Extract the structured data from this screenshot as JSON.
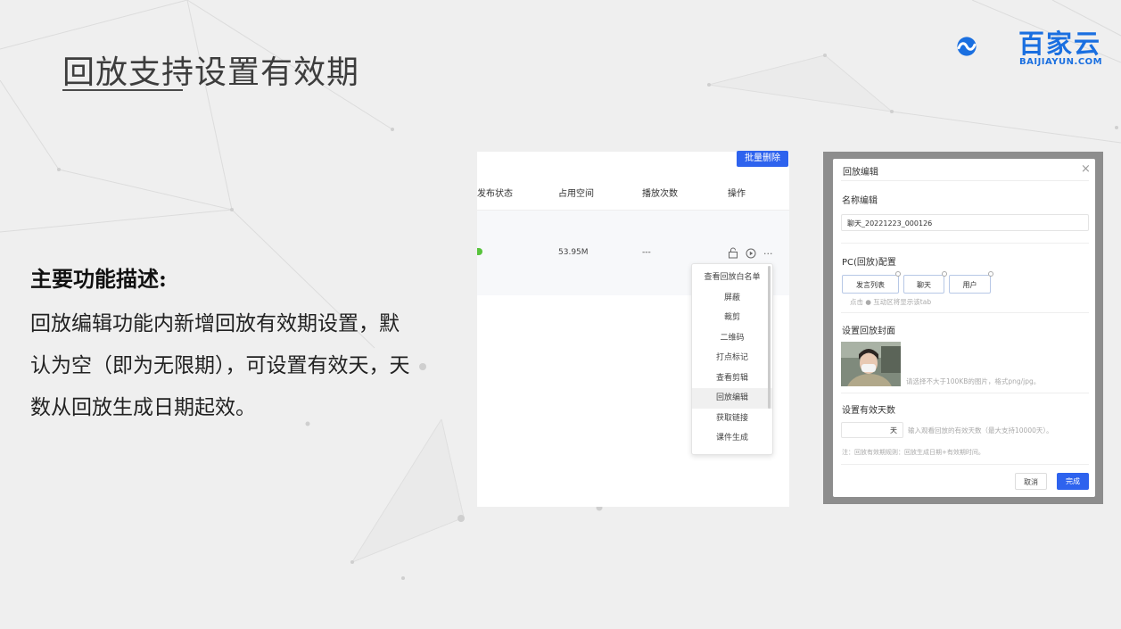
{
  "slide": {
    "title": "回放支持设置有效期"
  },
  "logo": {
    "name_cn": "百家云",
    "name_en": "BAIJIAYUN.COM"
  },
  "description": {
    "heading": "主要功能描述:",
    "body": "回放编辑功能内新增回放有效期设置，默认为空（即为无限期），可设置有效天，天数从回放生成日期起效。"
  },
  "list_panel": {
    "bulk_delete_label": "批量删除",
    "columns": [
      "发布状态",
      "占用空间",
      "播放次数",
      "操作"
    ],
    "row": {
      "size": "53.95M",
      "plays": "---",
      "more": "···"
    },
    "menu_items": [
      "查看回放白名单",
      "屏蔽",
      "裁剪",
      "二维码",
      "打点标记",
      "查看剪辑",
      "回放编辑",
      "获取链接",
      "课件生成"
    ],
    "active_menu_item": "回放编辑"
  },
  "dialog": {
    "title": "回放编辑",
    "close": "×",
    "name_label": "名称编辑",
    "name_value": "聊天_20221223_000126",
    "pc_label": "PC(回放)配置",
    "pc_tabs": [
      "发言列表",
      "聊天",
      "用户"
    ],
    "pc_hint": "点击 ● 互动区将显示该tab",
    "cover_label": "设置回放封面",
    "cover_hint": "请选择不大于100KB的图片，格式png/jpg。",
    "days_label": "设置有效天数",
    "days_unit": "天",
    "days_hint": "输入观看回放的有效天数（最大支持10000天）。",
    "rule_note": "注：回放有效期规则：回放生成日期+有效期时间。",
    "cancel_label": "取消",
    "ok_label": "完成"
  },
  "colors": {
    "accent": "#2e63ee",
    "logo_blue": "#1a6fe0",
    "status_green": "#58c33c"
  }
}
